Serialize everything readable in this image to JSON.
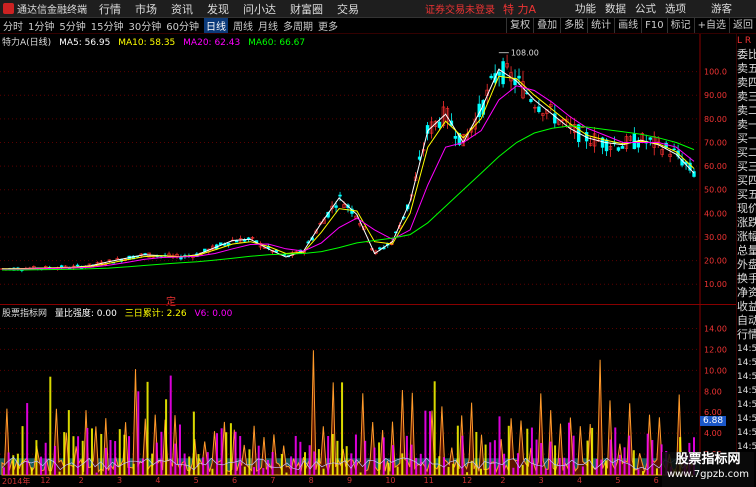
{
  "window": {
    "app_title": "通达信金融终端",
    "menu": [
      "行情",
      "市场",
      "资讯",
      "发现",
      "问小达",
      "财富圈",
      "交易"
    ],
    "notice": "证券交易未登录",
    "stock_title": "特 力A",
    "right_menu": [
      "功能",
      "数据",
      "公式",
      "选项"
    ],
    "guest": "游客"
  },
  "periods": {
    "items": [
      "分时",
      "1分钟",
      "5分钟",
      "15分钟",
      "30分钟",
      "60分钟",
      "日线",
      "周线",
      "月线",
      "多周期",
      "更多"
    ],
    "active": "日线"
  },
  "tools": [
    "复权",
    "叠加",
    "多股",
    "统计",
    "画线",
    "F10",
    "标记",
    "+自选",
    "返回"
  ],
  "main_header": {
    "name": "特力A(日线)",
    "ma5": "MA5: 56.95",
    "ma10": "MA10: 58.35",
    "ma20": "MA20: 62.43",
    "ma60": "MA60: 66.67"
  },
  "main_axis": [
    "100.0",
    "90.00",
    "80.00",
    "70.00",
    "60.00",
    "50.00",
    "40.00",
    "30.00",
    "20.00",
    "10.00"
  ],
  "high_label": "108.00",
  "marker_ding": "定",
  "indicator_header": {
    "name": "股票指标网",
    "l1": "量比强度: 0.00",
    "l2": "三日累计: 2.26",
    "l3": "V6: 0.00"
  },
  "sub_axis": [
    "14.00",
    "12.00",
    "10.00",
    "8.00",
    "6.00",
    "4.00",
    "2.00"
  ],
  "sub_badge": "6.88",
  "time_axis": [
    "2014年",
    "12",
    "2",
    "3",
    "4",
    "5",
    "6",
    "7",
    "8",
    "9",
    "10",
    "11",
    "12",
    "2",
    "3",
    "4",
    "5",
    "6"
  ],
  "right_panel": {
    "head": "L R",
    "items": [
      "委比",
      "卖五",
      "卖四",
      "卖三",
      "卖二",
      "卖一",
      "买一",
      "买二",
      "买三",
      "买四",
      "买五",
      "现价",
      "涨跌",
      "涨幅",
      "总量",
      "外盘",
      "换手",
      "净资",
      "收益",
      "自动",
      "行情",
      "14:56",
      "14:56",
      "14:56",
      "14:56",
      "14:56",
      "14:56",
      "14:56",
      "14:56"
    ]
  },
  "watermark": {
    "line1": "股票指标网",
    "line2": "www.7gpzb.com"
  },
  "colors": {
    "up": "#ff3030",
    "down": "#00ffff",
    "ma5": "#ffffff",
    "ma10": "#ffff00",
    "ma20": "#ff00ff",
    "ma60": "#00ff00",
    "grid": "#5a0000"
  },
  "chart_data": {
    "type": "line",
    "price_series": [
      {
        "name": "MA5",
        "values": [
          16.5,
          16.6,
          16.8,
          17.0,
          17.2,
          17.8,
          19.5,
          21.0,
          22.5,
          22.0,
          21.5,
          22.5,
          25.5,
          28.5,
          29.0,
          25.0,
          21.5,
          24.0,
          36.0,
          46.5,
          39.5,
          23.0,
          28.0,
          45.0,
          75.0,
          82.0,
          70.0,
          84.0,
          101.0,
          96.0,
          88.0,
          82.0,
          76.0,
          72.0,
          70.0,
          69.0,
          71.0,
          69.0,
          65.0,
          57.0
        ]
      },
      {
        "name": "MA10",
        "values": [
          16.4,
          16.5,
          16.7,
          16.9,
          17.1,
          17.5,
          18.8,
          20.3,
          21.7,
          22.0,
          21.7,
          22.2,
          24.5,
          27.0,
          28.0,
          26.0,
          23.0,
          23.5,
          32.0,
          42.0,
          41.0,
          28.0,
          27.0,
          40.0,
          68.0,
          79.0,
          72.0,
          80.0,
          98.0,
          97.0,
          90.0,
          84.0,
          78.0,
          73.0,
          71.0,
          69.5,
          70.5,
          69.5,
          66.0,
          59.0
        ]
      },
      {
        "name": "MA20",
        "values": [
          16.2,
          16.3,
          16.5,
          16.7,
          16.9,
          17.2,
          18.0,
          19.2,
          20.5,
          21.3,
          21.5,
          21.8,
          23.0,
          25.0,
          26.8,
          27.0,
          25.0,
          24.0,
          27.5,
          34.0,
          38.0,
          33.0,
          29.0,
          33.0,
          52.0,
          68.0,
          70.0,
          75.0,
          88.0,
          94.0,
          92.0,
          87.0,
          81.0,
          76.0,
          73.0,
          70.0,
          70.0,
          70.0,
          68.0,
          62.0
        ]
      },
      {
        "name": "MA60",
        "values": [
          16.0,
          16.0,
          16.1,
          16.2,
          16.3,
          16.5,
          16.8,
          17.3,
          17.9,
          18.5,
          19.0,
          19.5,
          20.2,
          21.0,
          21.8,
          22.5,
          22.8,
          23.0,
          23.8,
          25.5,
          27.5,
          28.5,
          29.5,
          31.0,
          36.0,
          43.0,
          50.0,
          57.0,
          64.0,
          70.0,
          74.0,
          76.0,
          77.0,
          76.5,
          75.5,
          74.5,
          73.5,
          72.0,
          70.0,
          67.0
        ]
      }
    ],
    "price_range": [
      5,
      110
    ],
    "volume_range": [
      0,
      15
    ],
    "x_labels": [
      "2014年",
      "12",
      "2",
      "3",
      "4",
      "5",
      "6",
      "7",
      "8",
      "9",
      "10",
      "11",
      "12",
      "2",
      "3",
      "4",
      "5",
      "6"
    ]
  }
}
